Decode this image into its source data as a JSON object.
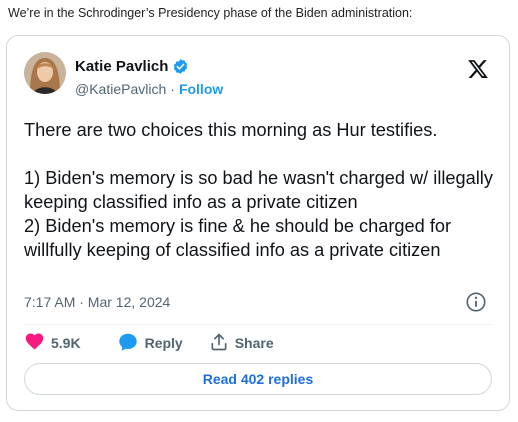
{
  "intro_text": "We’re in the Schrodinger’s Presidency phase of the Biden administration:",
  "tweet": {
    "author_name": "Katie Pavlich",
    "handle": "@KatiePavlich",
    "separator": "·",
    "follow_label": "Follow",
    "verified_color": "#1d9bf0",
    "text_paragraphs": [
      "There are two choices this morning as Hur testifies.",
      "1) Biden's memory is so bad he wasn't charged w/ illegally keeping classified info as a private citizen",
      "2) Biden's memory is fine & he should be charged for willfully keeping of classified info as a private citizen"
    ],
    "timestamp": "7:17 AM · Mar 12, 2024",
    "likes": "5.9K",
    "reply_label": "Reply",
    "share_label": "Share",
    "read_replies_label": "Read 402 replies",
    "like_color": "#f91880",
    "reply_color": "#1d9bf0",
    "icons": [
      "avatar",
      "verified-badge-icon",
      "x-logo-icon",
      "info-icon",
      "heart-icon",
      "reply-bubble-icon",
      "share-icon"
    ]
  }
}
